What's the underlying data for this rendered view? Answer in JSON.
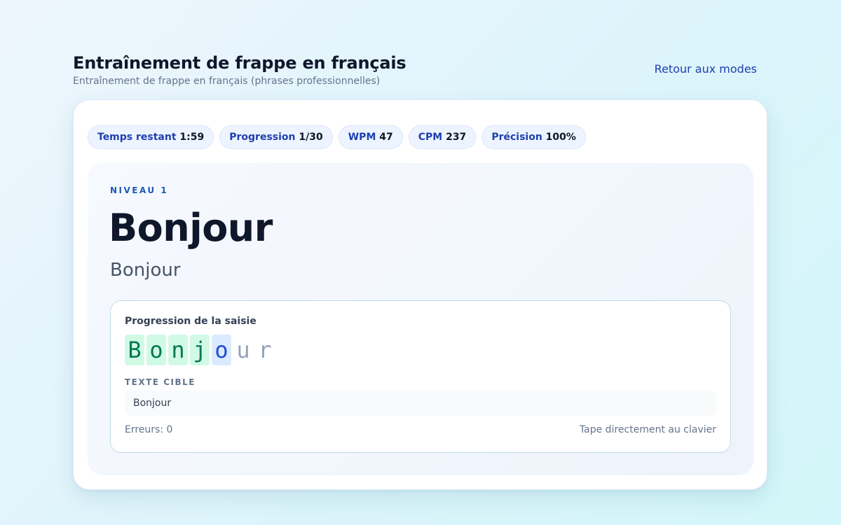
{
  "header": {
    "title": "Entraînement de frappe en français",
    "subtitle": "Entraînement de frappe en français (phrases professionnelles)",
    "back_label": "Retour aux modes"
  },
  "stats": [
    {
      "label": "Temps restant",
      "value": "1:59"
    },
    {
      "label": "Progression",
      "value": "1/30"
    },
    {
      "label": "WPM",
      "value": "47"
    },
    {
      "label": "CPM",
      "value": "237"
    },
    {
      "label": "Précision",
      "value": "100%"
    }
  ],
  "lesson": {
    "level": "NIVEAU 1",
    "word": "Bonjour",
    "translation": "Bonjour"
  },
  "typing": {
    "label": "Progression de la saisie",
    "chars": [
      {
        "char": "B",
        "state": "done"
      },
      {
        "char": "o",
        "state": "done"
      },
      {
        "char": "n",
        "state": "done"
      },
      {
        "char": "j",
        "state": "done"
      },
      {
        "char": "o",
        "state": "current"
      },
      {
        "char": "u",
        "state": "pending"
      },
      {
        "char": "r",
        "state": "pending"
      }
    ],
    "target_label": "TEXTE CIBLE",
    "target_text": "Bonjour",
    "errors": "Erreurs: 0",
    "hint": "Tape directement au clavier"
  },
  "colors": {
    "accent": "#1e40af",
    "correct_bg": "#d1fae5",
    "correct_text": "#047857",
    "current_bg": "#dbeafe",
    "pending_text": "#94a3b8"
  }
}
